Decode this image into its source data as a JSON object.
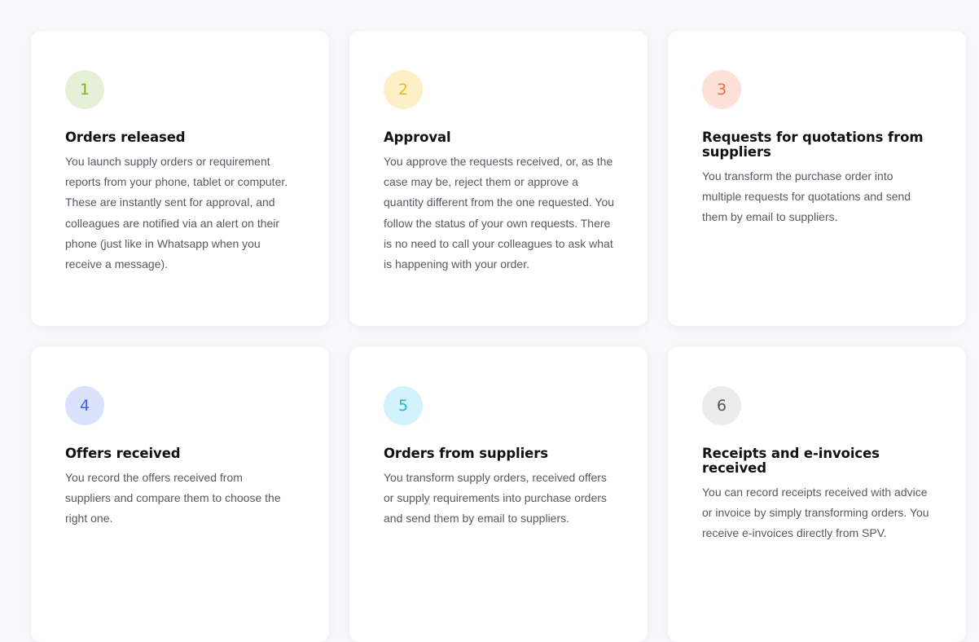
{
  "cards": [
    {
      "number": "1",
      "title": "Orders released",
      "description": "You launch supply orders or requirement reports from your phone, tablet or computer. These are instantly sent for approval, and colleagues are notified via an alert on their phone (just like in Whatsapp when you receive a message).",
      "badge_bg": "#e5f0d7",
      "badge_color": "#7fb32a"
    },
    {
      "number": "2",
      "title": "Approval",
      "description": "You approve the requests received, or, as the case may be, reject them or approve a quantity different from the one requested. You follow the status of your own requests. There is no need to call your colleagues to ask what is happening with your order.",
      "badge_bg": "#fdf0c6",
      "badge_color": "#f2b81b"
    },
    {
      "number": "3",
      "title": "Requests for quotations from suppliers",
      "description": "You transform the purchase order into multiple requests for quotations and send them by email to suppliers.",
      "badge_bg": "#fde0d8",
      "badge_color": "#f26a45"
    },
    {
      "number": "4",
      "title": "Offers received",
      "description": "You record the offers received from suppliers and compare them to choose the right one.",
      "badge_bg": "#d9e1fb",
      "badge_color": "#3d63e6"
    },
    {
      "number": "5",
      "title": "Orders from suppliers",
      "description": "You transform supply orders, received offers or supply requirements into purchase orders and send them by email to suppliers.",
      "badge_bg": "#d2f3fb",
      "badge_color": "#1fb6de"
    },
    {
      "number": "6",
      "title": "Receipts and e-invoices received",
      "description": "You can record receipts received with advice or invoice by simply transforming orders. You receive e-invoices directly from SPV.",
      "badge_bg": "#ececec",
      "badge_color": "#555555"
    }
  ]
}
